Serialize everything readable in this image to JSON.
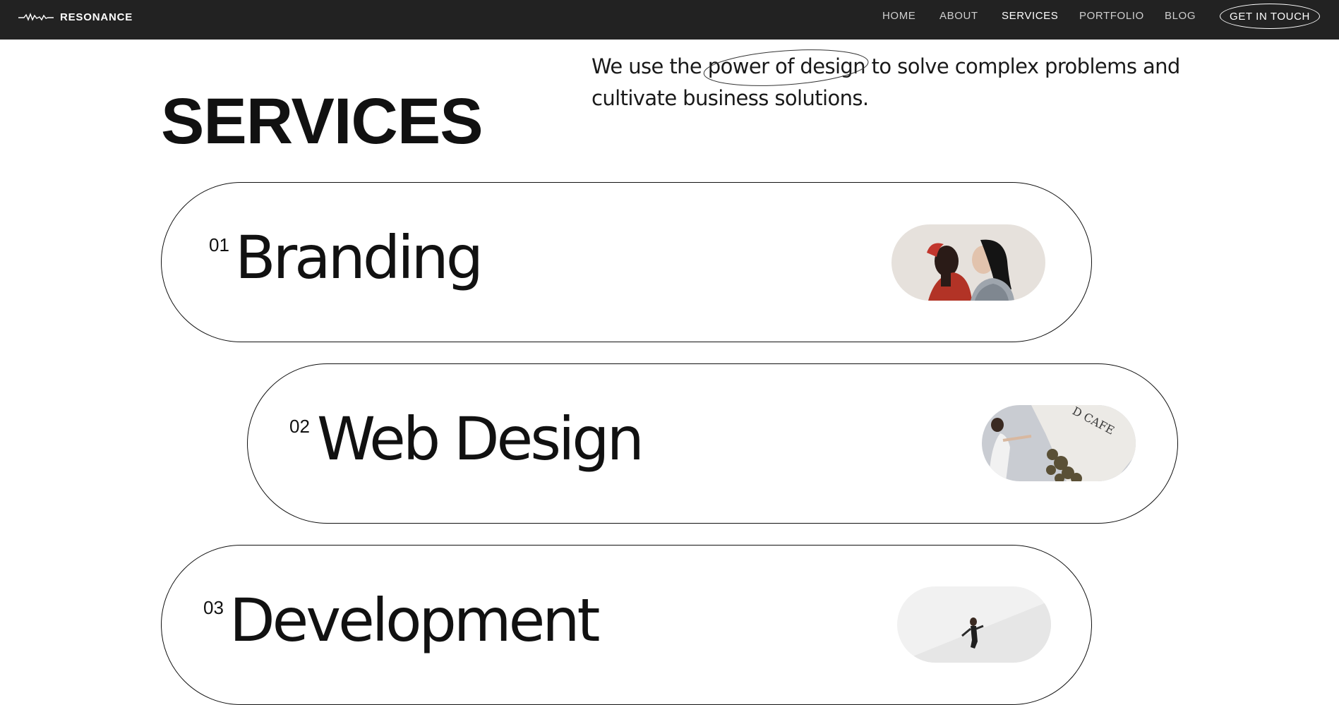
{
  "brand": {
    "name": "RESONANCE"
  },
  "nav": {
    "items": [
      {
        "label": "HOME",
        "active": false
      },
      {
        "label": "ABOUT",
        "active": false
      },
      {
        "label": "SERVICES",
        "active": true
      },
      {
        "label": "PORTFOLIO",
        "active": false
      },
      {
        "label": "BLOG",
        "active": false
      }
    ],
    "cta_label": "GET IN TOUCH"
  },
  "hero": {
    "title": "SERVICES",
    "intro_before": "We use the ",
    "intro_highlight": "power of design",
    "intro_after": " to solve complex problems and cultivate business solutions."
  },
  "services": [
    {
      "number": "01",
      "label": "Branding",
      "image": "couple-portrait-photo"
    },
    {
      "number": "02",
      "label": "Web Design",
      "image": "cafe-signage-photo"
    },
    {
      "number": "03",
      "label": "Development",
      "image": "figure-on-white-wall-photo"
    }
  ],
  "colors": {
    "topbar": "#222222",
    "text": "#111111",
    "background": "#ffffff"
  }
}
